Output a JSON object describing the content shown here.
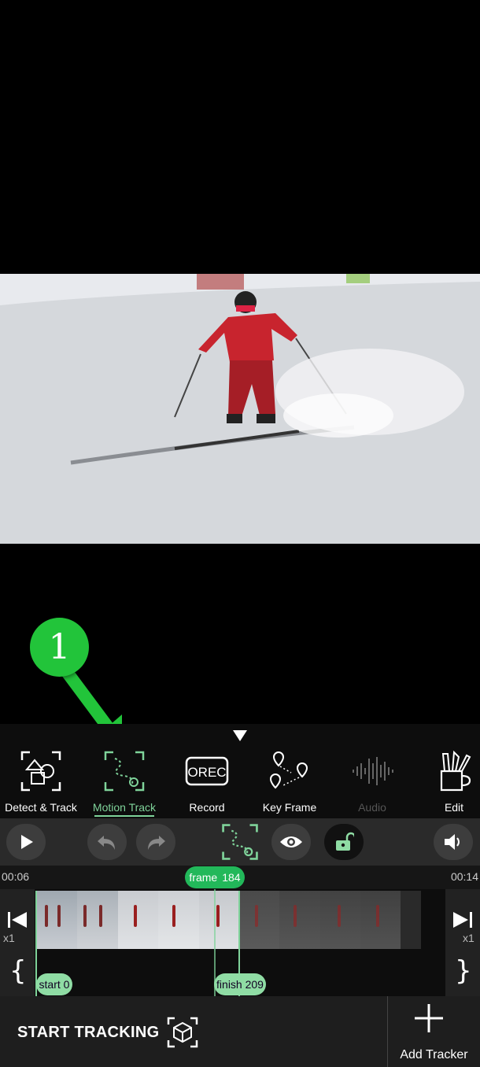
{
  "annotation": {
    "badge_number": "1"
  },
  "toolbar": {
    "tools": [
      {
        "label": "Detect & Track",
        "icon": "detect-track-icon"
      },
      {
        "label": "Motion Track",
        "icon": "motion-track-icon",
        "selected": true
      },
      {
        "label": "Record",
        "icon": "record-icon"
      },
      {
        "label": "Key Frame",
        "icon": "key-frame-icon"
      },
      {
        "label": "Audio",
        "icon": "audio-waveform-icon",
        "disabled": true
      },
      {
        "label": "Edit",
        "icon": "edit-tools-icon"
      }
    ]
  },
  "record_icon_text": "OREC",
  "controls": {
    "icons": [
      "play-icon",
      "undo-icon",
      "redo-icon",
      "motion-track-icon",
      "eye-icon",
      "lock-icon",
      "volume-icon"
    ]
  },
  "timeline": {
    "time_start": "00:06",
    "time_end": "00:14",
    "frame_label": "frame",
    "frame_value": "184",
    "start_label": "start 0",
    "finish_label": "finish 209",
    "speed_left": "x1",
    "speed_right": "x1",
    "brace_left": "{",
    "brace_right": "}"
  },
  "bottom": {
    "start_tracking": "START TRACKING",
    "add_tracker": "Add Tracker"
  },
  "colors": {
    "accent": "#22b85a",
    "accent_light": "#8fdca4",
    "badge": "#22c43a",
    "arrow": "#22c43a"
  }
}
